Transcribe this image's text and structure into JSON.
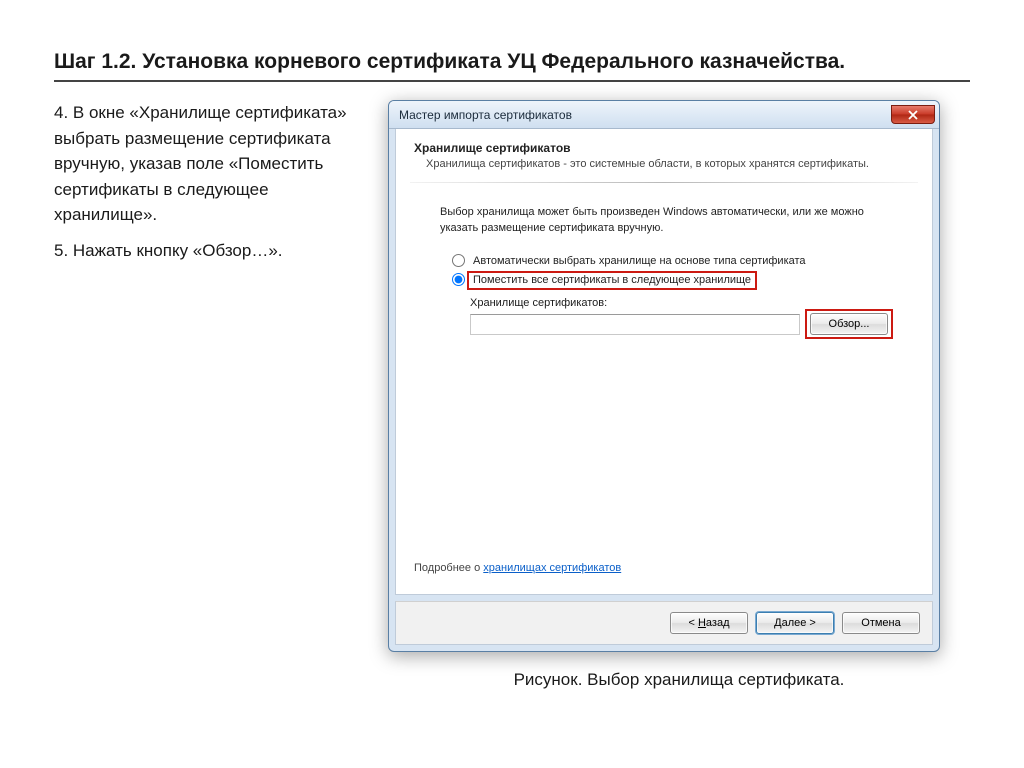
{
  "page": {
    "title": "Шаг 1.2. Установка корневого сертификата УЦ Федерального казначейства.",
    "step4": "4. В окне «Хранилище сертификата» выбрать размещение сертификата вручную, указав поле «Поместить сертификаты в следующее хранилище».",
    "step5": "5. Нажать кнопку «Обзор…».",
    "figure_caption": "Рисунок. Выбор хранилища сертификата."
  },
  "dialog": {
    "title": "Мастер импорта сертификатов",
    "section_header": "Хранилище сертификатов",
    "section_sub": "Хранилища сертификатов - это системные области, в которых хранятся сертификаты.",
    "intro": "Выбор хранилища может быть произведен Windows автоматически, или же можно указать размещение сертификата вручную.",
    "radio_auto": "Автоматически выбрать хранилище на основе типа сертификата",
    "radio_manual": "Поместить все сертификаты в следующее хранилище",
    "store_label": "Хранилище сертификатов:",
    "store_value": "",
    "browse": "Обзор...",
    "learn_prefix": "Подробнее о ",
    "learn_link": "хранилищах сертификатов",
    "back_prefix": "< ",
    "back_u": "Н",
    "back_rest": "азад",
    "next_u": "Д",
    "next_rest": "алее >",
    "cancel": "Отмена"
  }
}
